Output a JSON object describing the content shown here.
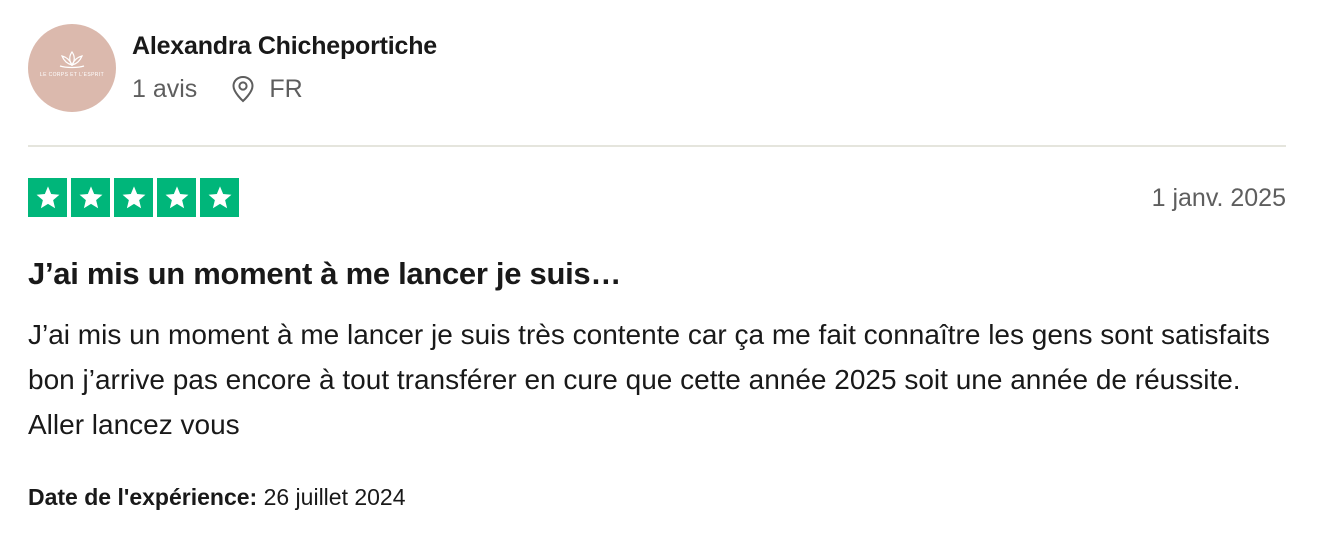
{
  "reviewer": {
    "name": "Alexandra Chicheportiche",
    "reviews_count": "1 avis",
    "country": "FR",
    "avatar_logo_text": "LE CORPS ET L'ESPRIT",
    "avatar_color": "#dbb9ad"
  },
  "review": {
    "rating": 5,
    "rating_max": 5,
    "star_color": "#00b67a",
    "date": "1 janv. 2025",
    "title": "J’ai mis un moment à me lancer je suis…",
    "body": "J’ai mis un moment à me lancer je suis très contente car ça me fait connaître les gens sont satisfaits bon j’arrive pas encore à tout transférer en cure que cette année 2025 soit une année de réussite. Aller lancez vous",
    "experience_label": "Date de l'expérience:",
    "experience_date": "26 juillet 2024"
  },
  "icons": {
    "location": "location-pin-icon",
    "star": "star-icon",
    "avatar_logo": "lotus-icon"
  }
}
